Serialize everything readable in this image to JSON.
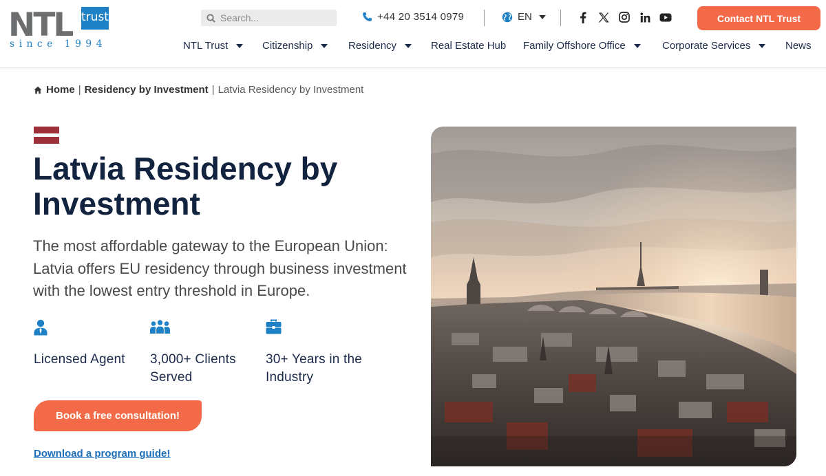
{
  "header": {
    "logo": {
      "letters": "NTL",
      "badge": "trust",
      "tagline": "since 1994"
    },
    "search": {
      "placeholder": "Search..."
    },
    "phone": "+44 20 3514 0979",
    "language": "EN",
    "socials": [
      "facebook-icon",
      "x-icon",
      "instagram-icon",
      "linkedin-icon",
      "youtube-icon"
    ],
    "contact_label": "Contact NTL Trust"
  },
  "nav": {
    "items": [
      {
        "label": "NTL Trust",
        "dropdown": true
      },
      {
        "label": "Citizenship",
        "dropdown": true
      },
      {
        "label": "Residency",
        "dropdown": true
      },
      {
        "label": "Real Estate Hub",
        "dropdown": false
      },
      {
        "label": "Family Offshore Office",
        "dropdown": true
      },
      {
        "label": "Corporate Services",
        "dropdown": true
      },
      {
        "label": "News",
        "dropdown": false
      }
    ]
  },
  "breadcrumb": {
    "home": "Home",
    "separator": "|",
    "section": "Residency by Investment",
    "current": "Latvia Residency by Investment"
  },
  "hero": {
    "title": "Latvia Residency by Investment",
    "lead": "The most affordable gateway to the European Union: Latvia offers EU residency through business investment with the lowest entry threshold in Europe.",
    "features": [
      {
        "icon": "agent-icon",
        "label": "Licensed Agent"
      },
      {
        "icon": "clients-icon",
        "label": "3,000+ Clients Served"
      },
      {
        "icon": "briefcase-icon",
        "label": "30+ Years in the Industry"
      }
    ],
    "cta_label": "Book a free consultation!",
    "guide_label": "Download a program guide!"
  },
  "colors": {
    "accent": "#f26a47",
    "brand_blue": "#1e80c5",
    "heading": "#12233f",
    "flag_red": "#9e3039"
  }
}
